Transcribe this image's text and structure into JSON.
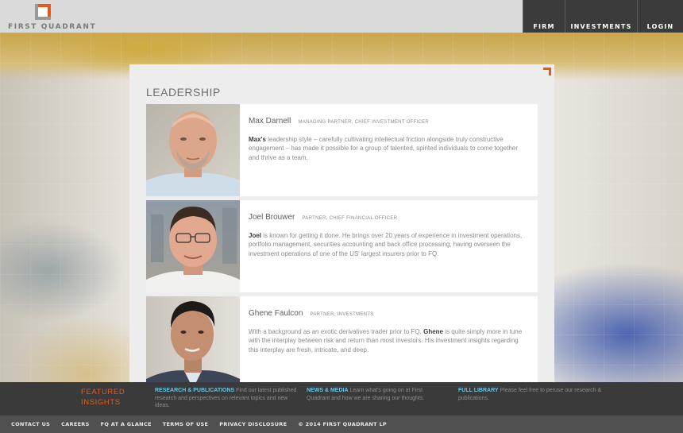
{
  "header": {
    "logo_text": "FIRST QUADRANT",
    "nav": [
      {
        "label": "FIRM"
      },
      {
        "label": "INVESTMENTS"
      },
      {
        "label": "LOGIN"
      }
    ]
  },
  "main": {
    "title": "LEADERSHIP",
    "people": [
      {
        "name": "Max Darnell",
        "title": "MANAGING PARTNER, CHIEF INVESTMENT OFFICER",
        "bio_bold": "Max's",
        "bio_rest": " leadership style – carefully cultivating intellectual friction alongside truly constructive engagement – has made it possible for a group of talented, spirited individuals to come together and thrive as a team."
      },
      {
        "name": "Joel Brouwer",
        "title": "PARTNER, CHIEF FINANCIAL OFFICER",
        "bio_bold": "Joel",
        "bio_rest": " is known for getting it done. He brings over 20 years of experience in investment operations, portfolio management, securities accounting and back office processing, having overseen the investment operations of one of the US' largest insurers prior to FQ."
      },
      {
        "name": "Ghene Faulcon",
        "title": "PARTNER, INVESTMENTS",
        "bio_pre": "With a background as an exotic derivatives trader prior to FQ, ",
        "bio_bold": "Ghene",
        "bio_rest": " is quite simply more in tune with the interplay between risk and return than most investors. His investment insights regarding this interplay are fresh, intricate, and deep."
      }
    ]
  },
  "featured": {
    "label_line1": "FEATURED",
    "label_line2": "INSIGHTS",
    "items": [
      {
        "title": "RESEARCH & PUBLICATIONS",
        "text": " Find our latest published research and perspectives on relevant topics and new ideas."
      },
      {
        "title": "NEWS & MEDIA",
        "text": " Learn what's going on at First Quadrant and how we are sharing our thoughts."
      },
      {
        "title": "FULL LIBRARY",
        "text": " Please feel free to peruse our research & publications."
      }
    ]
  },
  "footer": {
    "links": [
      "CONTACT US",
      "CAREERS",
      "FQ AT A GLANCE",
      "TERMS OF USE",
      "PRIVACY DISCLOSURE"
    ],
    "copyright": "© 2014 FIRST QUADRANT LP"
  },
  "colors": {
    "accent": "#e55a1c",
    "link": "#6cc3e6",
    "nav_bg": "#3b3b3b"
  }
}
